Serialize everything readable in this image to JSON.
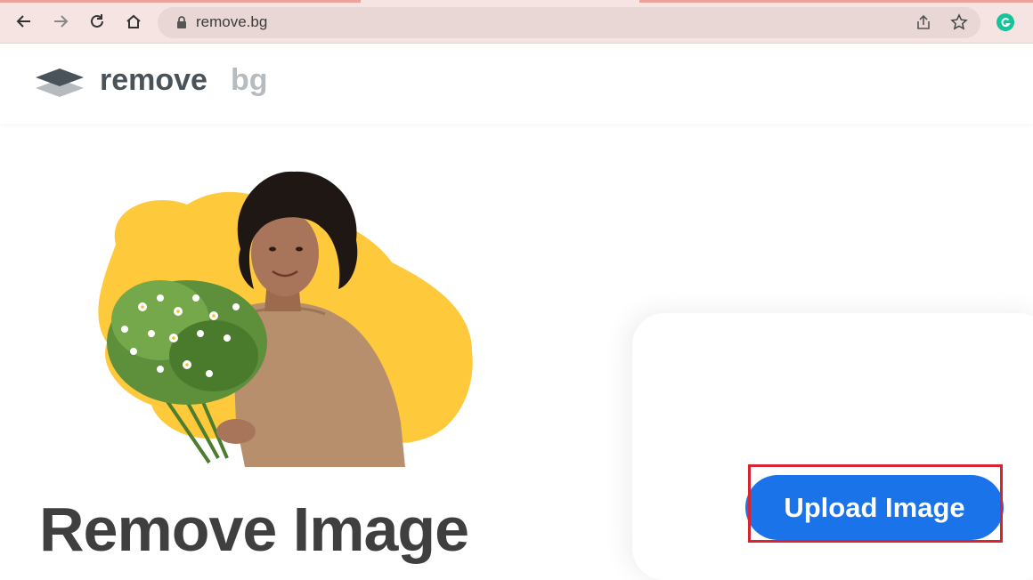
{
  "browser": {
    "url": "remove.bg",
    "icons": [
      "back-icon",
      "forward-icon",
      "reload-icon",
      "home-icon",
      "lock-icon",
      "share-icon",
      "star-icon",
      "grammarly-icon"
    ]
  },
  "site": {
    "logo": {
      "word1": "remove",
      "word2": "bg"
    },
    "hero_title": "Remove Image",
    "upload_button": "Upload Image"
  },
  "colors": {
    "accent": "#1a73e8",
    "highlight": "#d82330",
    "logo_dark": "#4a525a",
    "logo_light": "#b6bbc0",
    "blob": "#ffc93c"
  }
}
